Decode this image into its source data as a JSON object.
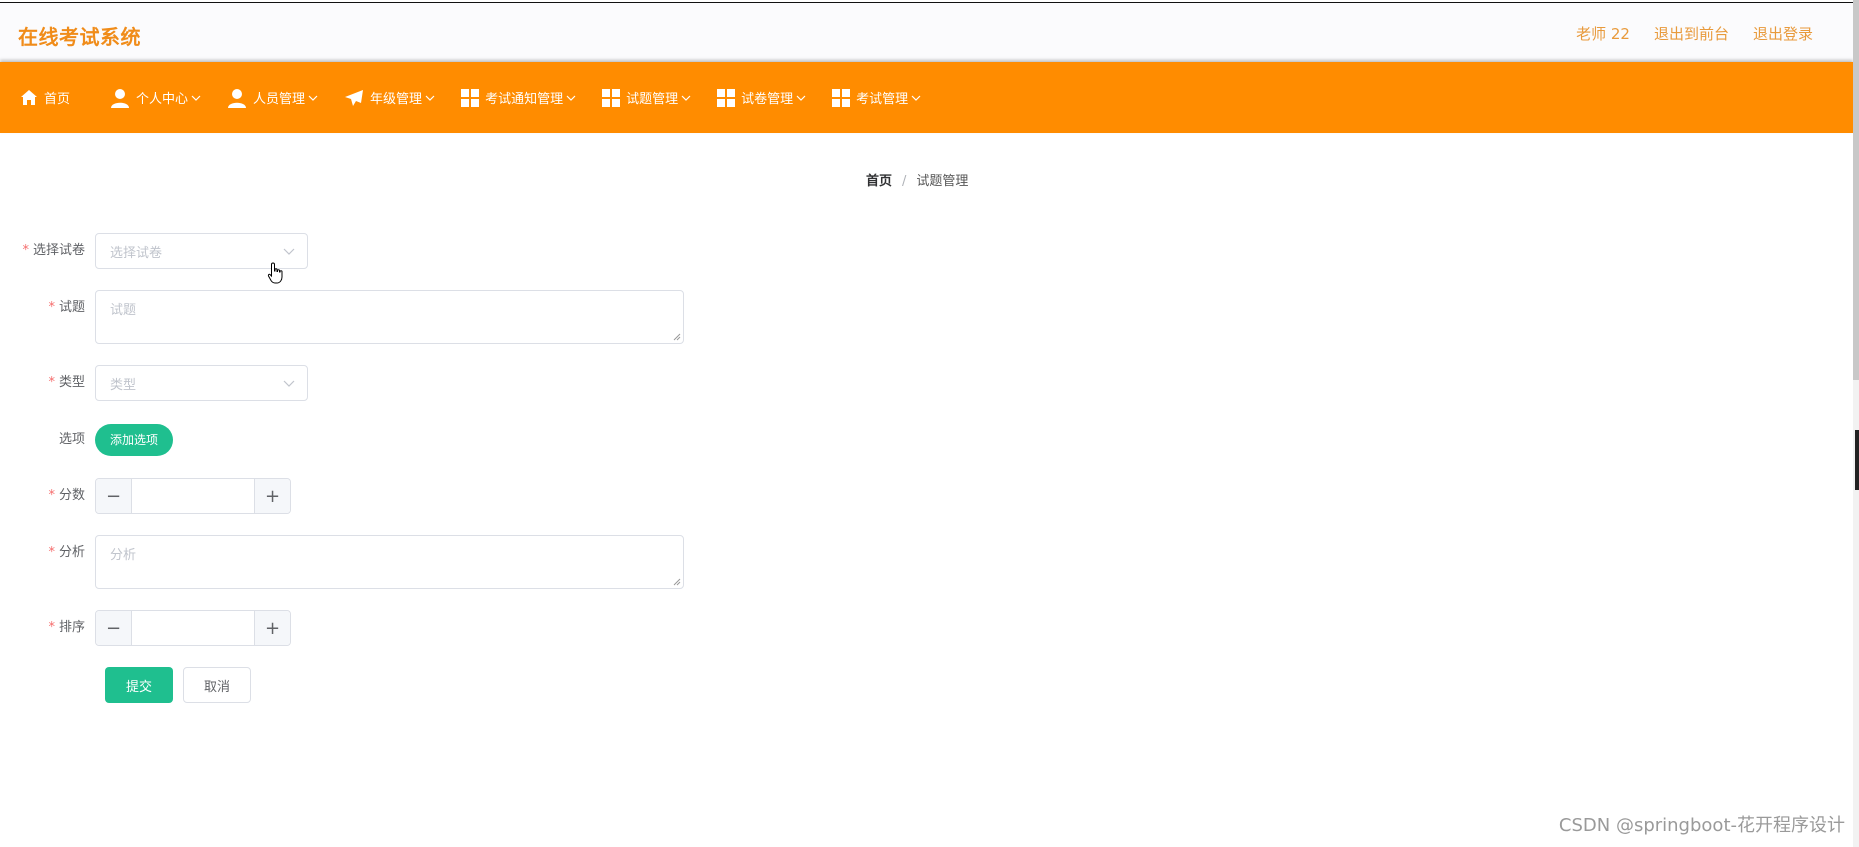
{
  "app": {
    "title": "在线考试系统"
  },
  "top_links": {
    "user": "老师 22",
    "to_front": "退出到前台",
    "logout": "退出登录"
  },
  "nav": {
    "home": "首页",
    "items": [
      "个人中心",
      "人员管理",
      "年级管理",
      "考试通知管理",
      "试题管理",
      "试卷管理",
      "考试管理"
    ]
  },
  "breadcrumb": {
    "home": "首页",
    "separator": "/",
    "current": "试题管理"
  },
  "form": {
    "paper": {
      "label": "选择试卷",
      "placeholder": "选择试卷"
    },
    "question": {
      "label": "试题",
      "placeholder": "试题"
    },
    "type": {
      "label": "类型",
      "placeholder": "类型"
    },
    "options": {
      "label": "选项",
      "add_button": "添加选项"
    },
    "score": {
      "label": "分数",
      "value": ""
    },
    "analysis": {
      "label": "分析",
      "placeholder": "分析"
    },
    "order": {
      "label": "排序",
      "value": ""
    },
    "required_mark": "*",
    "submit": "提交",
    "cancel": "取消"
  },
  "watermark": "CSDN @springboot-花开程序设计",
  "colors": {
    "accent": "#ff8c00",
    "primary": "#1fbf8f",
    "logo": "#f08c1a",
    "required": "#f56c6c"
  }
}
